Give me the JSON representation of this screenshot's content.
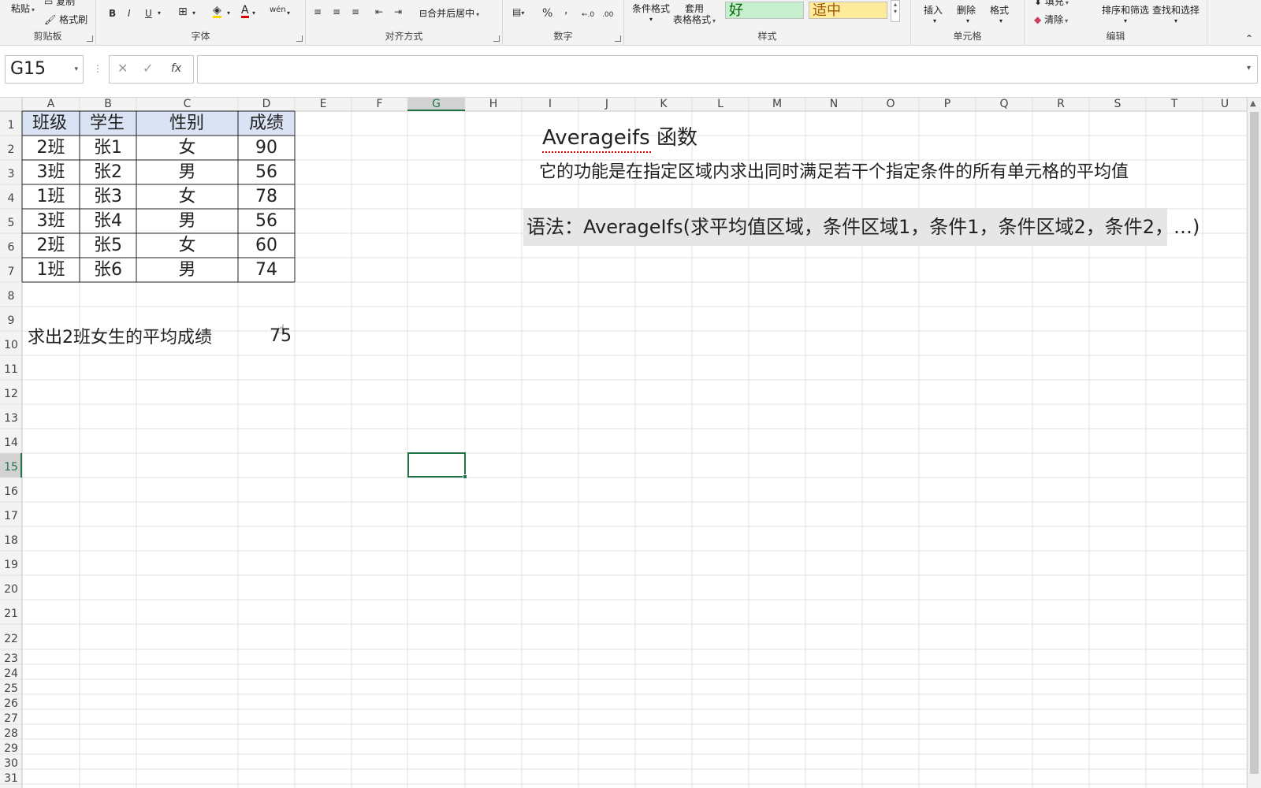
{
  "ribbon": {
    "clipboard": {
      "paste": "粘贴",
      "copy": "复制",
      "format_painter": "格式刷",
      "label": "剪贴板"
    },
    "font": {
      "bold": "B",
      "italic": "I",
      "underline": "U",
      "font_color": "A",
      "wen": "wén",
      "label": "字体"
    },
    "alignment": {
      "merge_center": "合并后居中",
      "label": "对齐方式"
    },
    "number": {
      "percent": "%",
      "comma": ",",
      "inc_decimal": "←.0",
      "dec_decimal": ".00",
      "label": "数字"
    },
    "styles": {
      "conditional": "条件格式",
      "table_format_1": "套用",
      "table_format_2": "表格格式",
      "good": "好",
      "neutral": "适中",
      "label": "样式"
    },
    "cells": {
      "insert": "插入",
      "delete": "删除",
      "format": "格式",
      "label": "单元格"
    },
    "editing": {
      "fill": "填充",
      "clear": "清除",
      "sort_filter": "排序和筛选",
      "find_select": "查找和选择",
      "label": "编辑"
    }
  },
  "formula_bar": {
    "name_box": "G15",
    "cancel": "✕",
    "enter": "✓",
    "fx": "fx",
    "value": ""
  },
  "columns": [
    "A",
    "B",
    "C",
    "D",
    "E",
    "F",
    "G",
    "H",
    "I",
    "J",
    "K",
    "L",
    "M",
    "N",
    "O",
    "P",
    "Q",
    "R",
    "S",
    "T",
    "U"
  ],
  "rows": [
    "1",
    "2",
    "3",
    "4",
    "5",
    "6",
    "7",
    "8",
    "9",
    "10",
    "11",
    "12",
    "13",
    "14",
    "15",
    "16",
    "17",
    "18",
    "19",
    "20",
    "21",
    "22",
    "23",
    "24",
    "25",
    "26",
    "27",
    "28",
    "29",
    "30",
    "31"
  ],
  "table": {
    "headers": [
      "班级",
      "学生",
      "性别",
      "成绩"
    ],
    "data": [
      [
        "2班",
        "张1",
        "女",
        "90"
      ],
      [
        "3班",
        "张2",
        "男",
        "56"
      ],
      [
        "1班",
        "张3",
        "女",
        "78"
      ],
      [
        "3班",
        "张4",
        "男",
        "56"
      ],
      [
        "2班",
        "张5",
        "女",
        "60"
      ],
      [
        "1班",
        "张6",
        "男",
        "74"
      ]
    ]
  },
  "question": {
    "label": "求出2班女生的平均成绩",
    "result": "75"
  },
  "notes": {
    "title": "Averageifs 函数",
    "description": "它的功能是在指定区域内求出同时满足若干个指定条件的所有单元格的平均值",
    "syntax": "语法：AverageIfs(求平均值区域，条件区域1，条件1，条件区域2，条件2，…)"
  },
  "colors": {
    "header_fill": "#dae3f3",
    "selection": "#217346",
    "syntax_fill": "#e7e6e6",
    "grid": "#e1e1e1"
  }
}
